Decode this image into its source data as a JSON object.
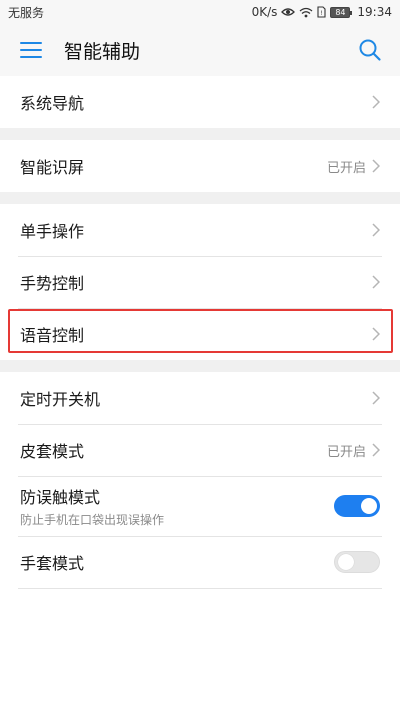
{
  "status_bar": {
    "carrier": "无服务",
    "speed": "0K/s",
    "battery": "84",
    "time": "19:34"
  },
  "app_bar": {
    "title": "智能辅助",
    "accent_color": "#1e88e5"
  },
  "sections": [
    {
      "items": [
        {
          "label": "系统导航"
        }
      ]
    },
    {
      "items": [
        {
          "label": "智能识屏",
          "status": "已开启"
        }
      ]
    },
    {
      "items": [
        {
          "label": "单手操作"
        },
        {
          "label": "手势控制"
        },
        {
          "label": "语音控制",
          "highlighted": true
        }
      ]
    },
    {
      "items": [
        {
          "label": "定时开关机"
        },
        {
          "label": "皮套模式",
          "status": "已开启"
        },
        {
          "label": "防误触模式",
          "subtitle": "防止手机在口袋出现误操作",
          "toggle": "on"
        },
        {
          "label": "手套模式",
          "toggle": "off"
        }
      ]
    }
  ]
}
